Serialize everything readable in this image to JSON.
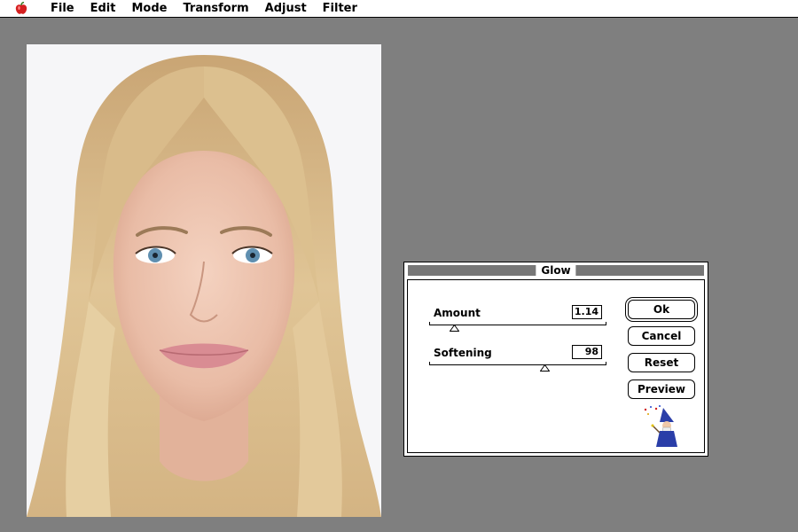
{
  "menubar": {
    "apple_icon": "apple-icon",
    "items": [
      "File",
      "Edit",
      "Mode",
      "Transform",
      "Adjust",
      "Filter"
    ]
  },
  "dialog": {
    "title": "Glow",
    "amount": {
      "label": "Amount",
      "value": "1.14",
      "level": 0.14
    },
    "softening": {
      "label": "Softening",
      "value": "98",
      "level": 0.65
    },
    "buttons": {
      "ok": "Ok",
      "cancel": "Cancel",
      "reset": "Reset",
      "preview": "Preview"
    },
    "logo_icon": "wizard-logo-icon"
  },
  "colors": {
    "desktop": "#7f7f7f",
    "titlebar_stripe": "#777777"
  }
}
